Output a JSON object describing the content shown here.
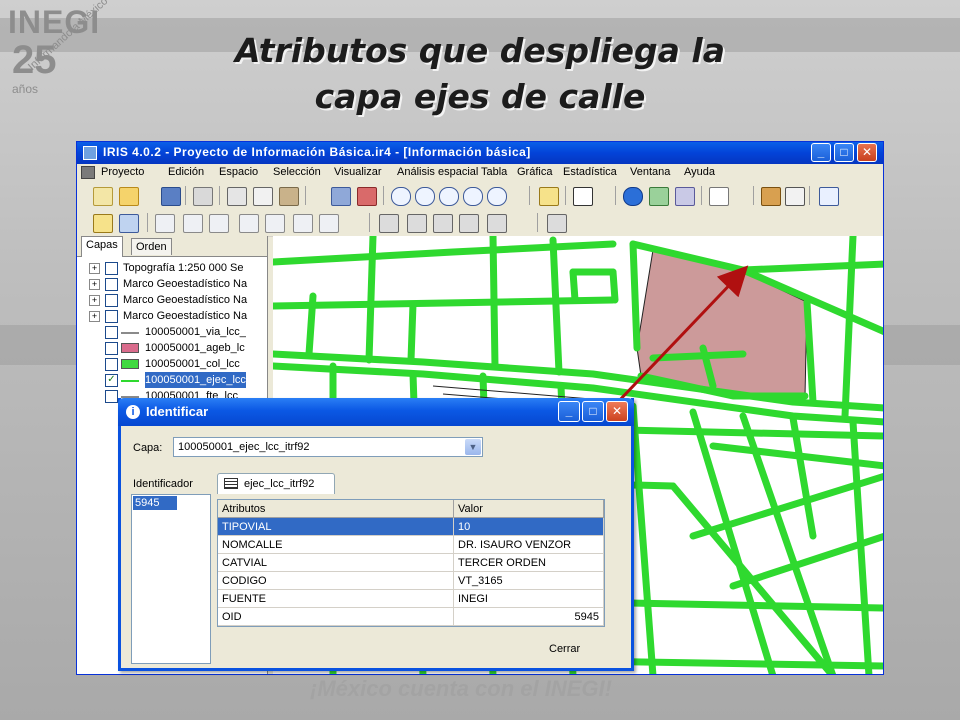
{
  "slide": {
    "title_line1": "Atributos que despliega la",
    "title_line2": "capa ejes de calle",
    "logo_text": "INEGI",
    "logo_number": "25",
    "logo_years": "años",
    "logo_tagline": "Informando a México",
    "footer_text": "¡México cuenta con el INEGI!"
  },
  "app": {
    "title": "IRIS 4.0.2 - Proyecto de Información Básica.ir4 - [Información básica]",
    "menu": [
      "Proyecto",
      "Edición",
      "Espacio",
      "Selección",
      "Visualizar",
      "Análisis espacial",
      "Tabla",
      "Gráfica",
      "Estadística",
      "Ventana",
      "Ayuda"
    ],
    "window_buttons": {
      "minimize": "_",
      "maximize": "□",
      "close": "✕"
    }
  },
  "left_panel": {
    "tabs": [
      "Capas",
      "Orden"
    ],
    "layers": [
      {
        "label": "Topografía 1:250 000 Se",
        "expander": "+",
        "checked": false,
        "symbol": null
      },
      {
        "label": "Marco Geoestadístico Na",
        "expander": "+",
        "checked": false,
        "symbol": null
      },
      {
        "label": "Marco Geoestadístico Na",
        "expander": "+",
        "checked": false,
        "symbol": null
      },
      {
        "label": "Marco Geoestadístico Na",
        "expander": "+",
        "checked": false,
        "symbol": null
      },
      {
        "label": "100050001_via_lcc_",
        "expander": "",
        "checked": false,
        "symbol": "line-gray"
      },
      {
        "label": "100050001_ageb_lc",
        "expander": "",
        "checked": false,
        "symbol": "fill-pink"
      },
      {
        "label": "100050001_col_lcc",
        "expander": "",
        "checked": false,
        "symbol": "fill-green"
      },
      {
        "label": "100050001_ejec_lcc",
        "expander": "",
        "checked": true,
        "symbol": "line-green",
        "selected": true
      },
      {
        "label": "100050001_fte_lcc",
        "expander": "",
        "checked": false,
        "symbol": "line-gray"
      }
    ],
    "checkmark": "✓"
  },
  "dialog": {
    "title": "Identificar",
    "capa_label": "Capa:",
    "capa_value": "100050001_ejec_lcc_itrf92",
    "identificador_label": "Identificador",
    "identificador_items": [
      "5945"
    ],
    "tab_label": "ejec_lcc_itrf92",
    "columns": [
      "Atributos",
      "Valor"
    ],
    "rows": [
      {
        "attr": "TIPOVIAL",
        "value": "10",
        "selected": true
      },
      {
        "attr": "NOMCALLE",
        "value": "DR. ISAURO VENZOR"
      },
      {
        "attr": "CATVIAL",
        "value": "TERCER ORDEN"
      },
      {
        "attr": "CODIGO",
        "value": "VT_3165"
      },
      {
        "attr": "FUENTE",
        "value": "INEGI"
      },
      {
        "attr": "OID",
        "value": "5945",
        "numeric": true
      }
    ],
    "close_label": "Cerrar"
  },
  "colors": {
    "street_green": "#2fd92f",
    "block_fill": "#ffffff",
    "ageb_fill": "#cc9a9a",
    "arrow": "#b01010",
    "selection": "#316ac5"
  }
}
